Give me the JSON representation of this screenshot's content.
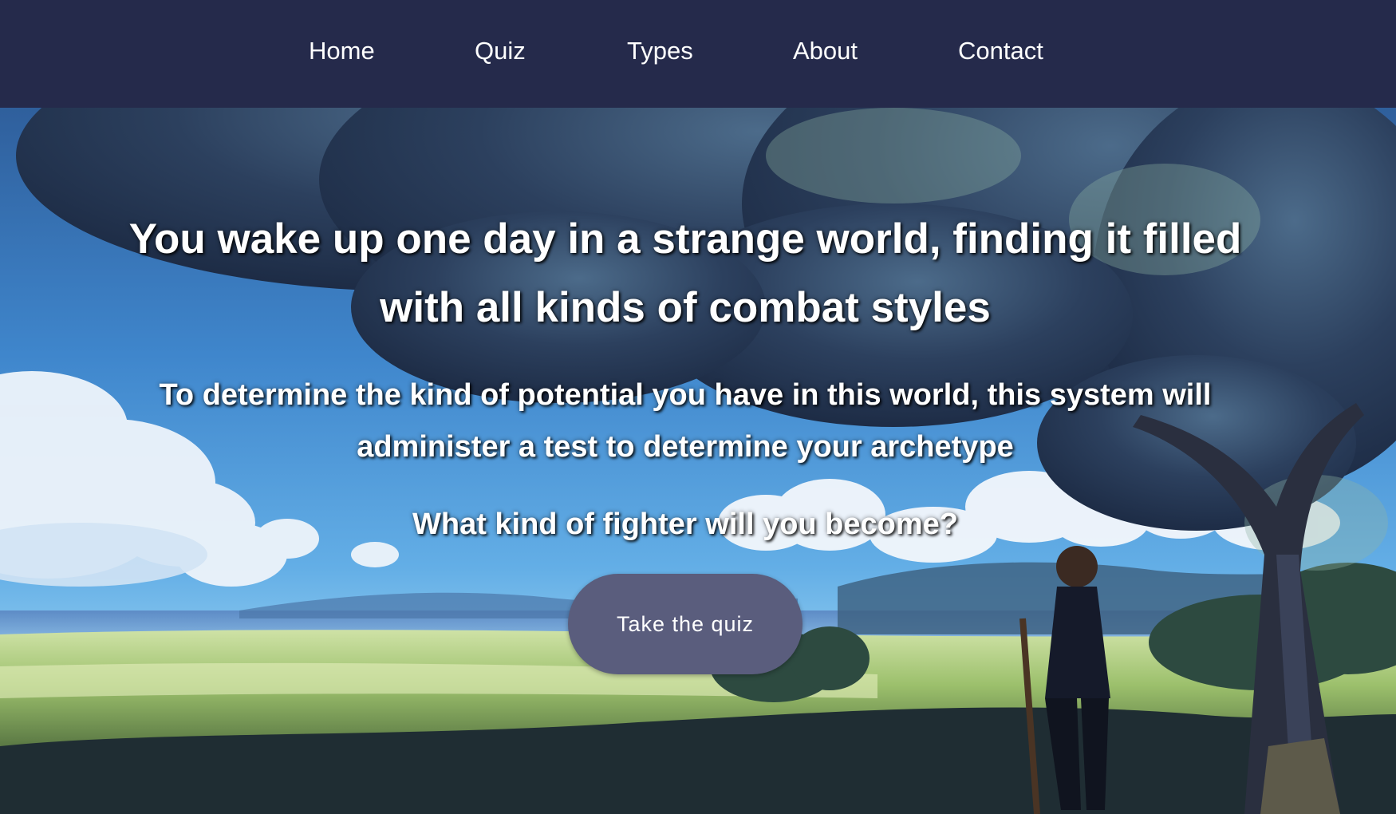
{
  "nav": {
    "items": [
      {
        "label": "Home"
      },
      {
        "label": "Quiz"
      },
      {
        "label": "Types"
      },
      {
        "label": "About"
      },
      {
        "label": "Contact"
      }
    ],
    "background": "#252a4b"
  },
  "hero": {
    "heading": "You wake up one day in a strange world, finding it filled with all kinds of combat styles",
    "subtext": "To determine the kind of potential you have in this world, this system will administer a test to determine your archetype",
    "question": "What kind of fighter will you become?",
    "cta_label": "Take the quiz",
    "cta_color": "#5a5d7d",
    "background_image": "anime-landscape-tree-sky-character"
  }
}
